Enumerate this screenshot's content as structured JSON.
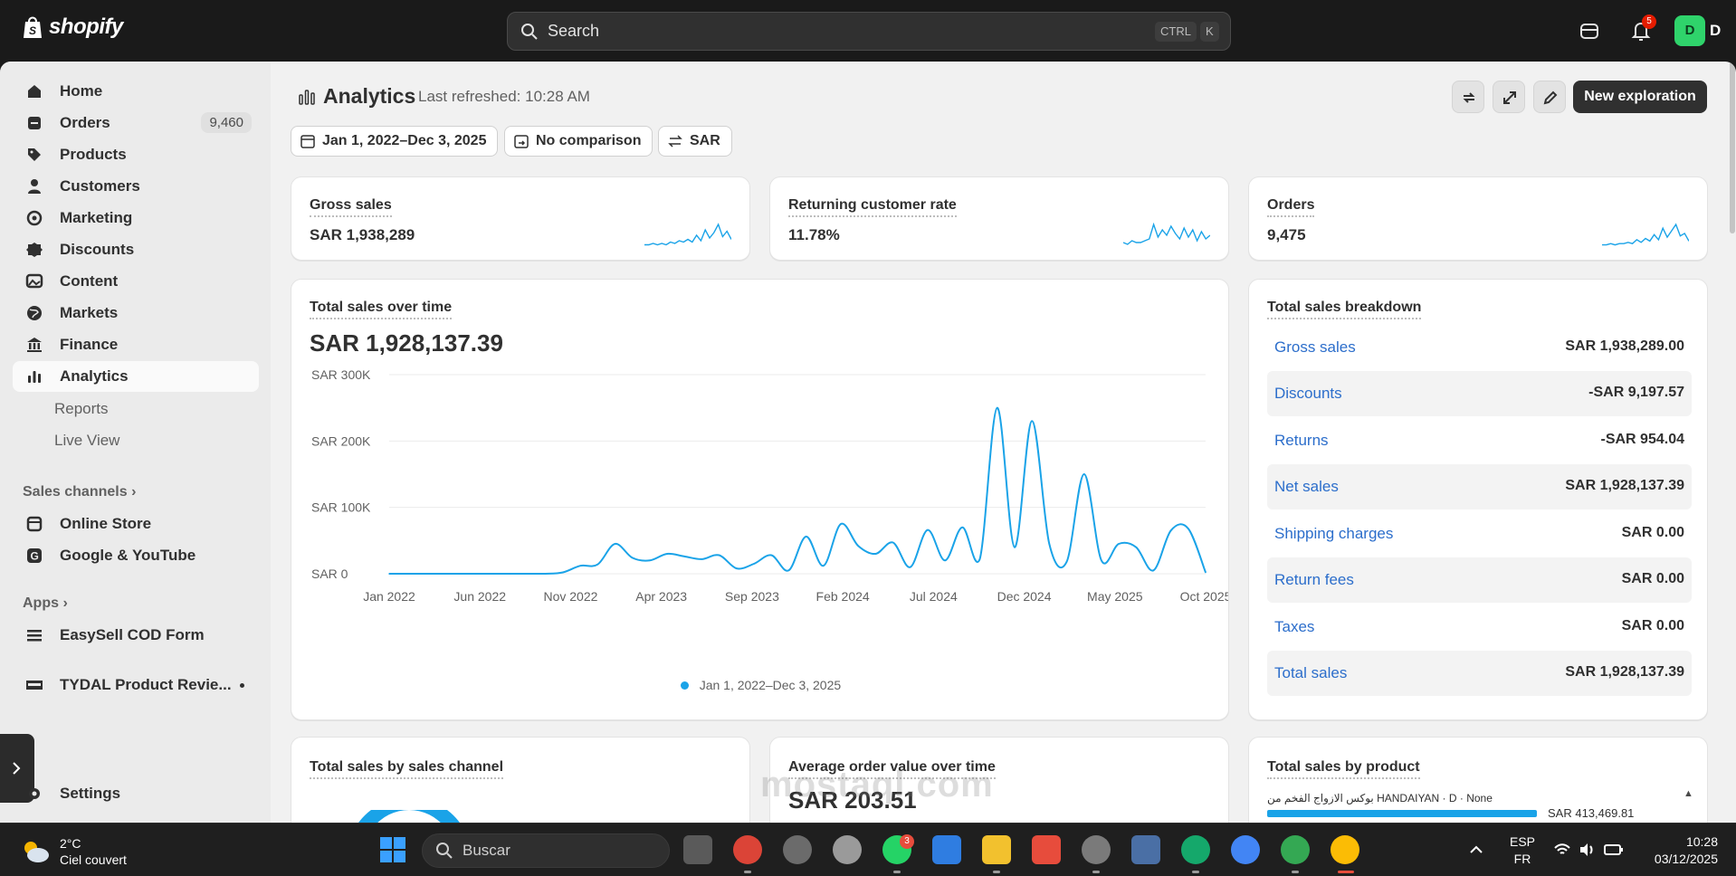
{
  "topbar": {
    "brand": "shopify",
    "search_placeholder": "Search",
    "shortcut_ctrl": "CTRL",
    "shortcut_key": "K",
    "notification_count": "5",
    "avatar_initial": "D",
    "user_initial": "D"
  },
  "sidebar": {
    "items": [
      {
        "label": "Home",
        "icon": "home-icon"
      },
      {
        "label": "Orders",
        "icon": "orders-icon",
        "badge": "9,460"
      },
      {
        "label": "Products",
        "icon": "tag-icon"
      },
      {
        "label": "Customers",
        "icon": "person-icon"
      },
      {
        "label": "Marketing",
        "icon": "target-icon"
      },
      {
        "label": "Discounts",
        "icon": "discount-icon"
      },
      {
        "label": "Content",
        "icon": "image-icon"
      },
      {
        "label": "Markets",
        "icon": "globe-icon"
      },
      {
        "label": "Finance",
        "icon": "bank-icon"
      },
      {
        "label": "Analytics",
        "icon": "bar-chart-icon"
      }
    ],
    "analytics_sub": [
      "Reports",
      "Live View"
    ],
    "sales_channels_label": "Sales channels",
    "channels": [
      "Online Store",
      "Google & YouTube"
    ],
    "apps_label": "Apps",
    "apps": [
      "EasySell COD Form",
      "TYDAL Product Revie..."
    ],
    "settings_label": "Settings"
  },
  "header": {
    "title": "Analytics",
    "last_refreshed": "Last refreshed: 10:28 AM",
    "new_button": "New exploration"
  },
  "filters": {
    "date_range": "Jan 1, 2022–Dec 3, 2025",
    "comparison": "No comparison",
    "currency": "SAR"
  },
  "metrics": [
    {
      "title": "Gross sales",
      "value": "SAR 1,938,289"
    },
    {
      "title": "Returning customer rate",
      "value": "11.78%"
    },
    {
      "title": "Orders",
      "value": "9,475"
    }
  ],
  "sales_over_time": {
    "title": "Total sales over time",
    "total": "SAR 1,928,137.39",
    "legend": "Jan 1, 2022–Dec 3, 2025"
  },
  "breakdown": {
    "title": "Total sales breakdown",
    "rows": [
      {
        "label": "Gross sales",
        "value": "SAR 1,938,289.00"
      },
      {
        "label": "Discounts",
        "value": "-SAR 9,197.57"
      },
      {
        "label": "Returns",
        "value": "-SAR 954.04"
      },
      {
        "label": "Net sales",
        "value": "SAR 1,928,137.39"
      },
      {
        "label": "Shipping charges",
        "value": "SAR 0.00"
      },
      {
        "label": "Return fees",
        "value": "SAR 0.00"
      },
      {
        "label": "Taxes",
        "value": "SAR 0.00"
      },
      {
        "label": "Total sales",
        "value": "SAR 1,928,137.39"
      }
    ]
  },
  "bottom_cards": {
    "by_channel_title": "Total sales by sales channel",
    "aov_title": "Average order value over time",
    "aov_value": "SAR 203.51",
    "by_product_title": "Total sales by product",
    "top_product": "بوكس الازواج الفخم من HANDAIYAN · D · None",
    "top_product_value": "SAR 413,469.81"
  },
  "taskbar": {
    "temperature": "2°C",
    "condition": "Ciel couvert",
    "search_placeholder": "Buscar",
    "whatsapp_badge": "3",
    "lang_top": "ESP",
    "lang_bottom": "FR",
    "time": "10:28",
    "date": "03/12/2025"
  },
  "watermark": "mostaql.com",
  "colors": {
    "accent": "#1aa3e8",
    "link": "#2c6ecb",
    "topbar": "#1a1a1a",
    "page_bg": "#f1f1f1"
  },
  "chart_data": {
    "type": "line",
    "title": "Total sales over time",
    "ylabel": "",
    "xlabel": "",
    "y_ticks": [
      "SAR 0",
      "SAR 100K",
      "SAR 200K",
      "SAR 300K"
    ],
    "ylim": [
      0,
      300000
    ],
    "x_ticks": [
      "Jan 2022",
      "Jun 2022",
      "Nov 2022",
      "Apr 2023",
      "Sep 2023",
      "Feb 2024",
      "Jul 2024",
      "Dec 2024",
      "May 2025",
      "Oct 2025"
    ],
    "series": [
      {
        "name": "Jan 1, 2022–Dec 3, 2025",
        "x": [
          "2022-01",
          "2022-02",
          "2022-03",
          "2022-04",
          "2022-05",
          "2022-06",
          "2022-07",
          "2022-08",
          "2022-09",
          "2022-10",
          "2022-11",
          "2022-12",
          "2023-01",
          "2023-02",
          "2023-03",
          "2023-04",
          "2023-05",
          "2023-06",
          "2023-07",
          "2023-08",
          "2023-09",
          "2023-10",
          "2023-11",
          "2023-12",
          "2024-01",
          "2024-02",
          "2024-03",
          "2024-04",
          "2024-05",
          "2024-06",
          "2024-07",
          "2024-08",
          "2024-09",
          "2024-10",
          "2024-11",
          "2024-12",
          "2025-01",
          "2025-02",
          "2025-03",
          "2025-04",
          "2025-05",
          "2025-06",
          "2025-07",
          "2025-08",
          "2025-09",
          "2025-10",
          "2025-11",
          "2025-12"
        ],
        "values": [
          0,
          0,
          0,
          0,
          0,
          0,
          0,
          0,
          0,
          0,
          2000,
          12000,
          14000,
          45000,
          24000,
          20000,
          30000,
          26000,
          22000,
          28000,
          8000,
          15000,
          28000,
          5000,
          56000,
          12000,
          75000,
          42000,
          30000,
          47000,
          10000,
          66000,
          20000,
          70000,
          22000,
          250000,
          40000,
          230000,
          45000,
          18000,
          150000,
          20000,
          45000,
          40000,
          5000,
          65000,
          68000,
          2000
        ]
      }
    ]
  },
  "sparklines": {
    "gross_sales": [
      1,
      1,
      2,
      1,
      2,
      1,
      3,
      2,
      4,
      3,
      5,
      3,
      8,
      4,
      12,
      6,
      10,
      16,
      7,
      11,
      5
    ],
    "returning_rate": [
      2,
      1,
      3,
      2,
      2,
      3,
      4,
      12,
      5,
      9,
      6,
      11,
      7,
      4,
      10,
      5,
      9,
      3,
      8,
      4,
      6
    ],
    "orders": [
      1,
      1,
      2,
      1,
      2,
      2,
      3,
      2,
      5,
      3,
      6,
      4,
      9,
      5,
      14,
      7,
      12,
      17,
      8,
      10,
      4
    ]
  }
}
